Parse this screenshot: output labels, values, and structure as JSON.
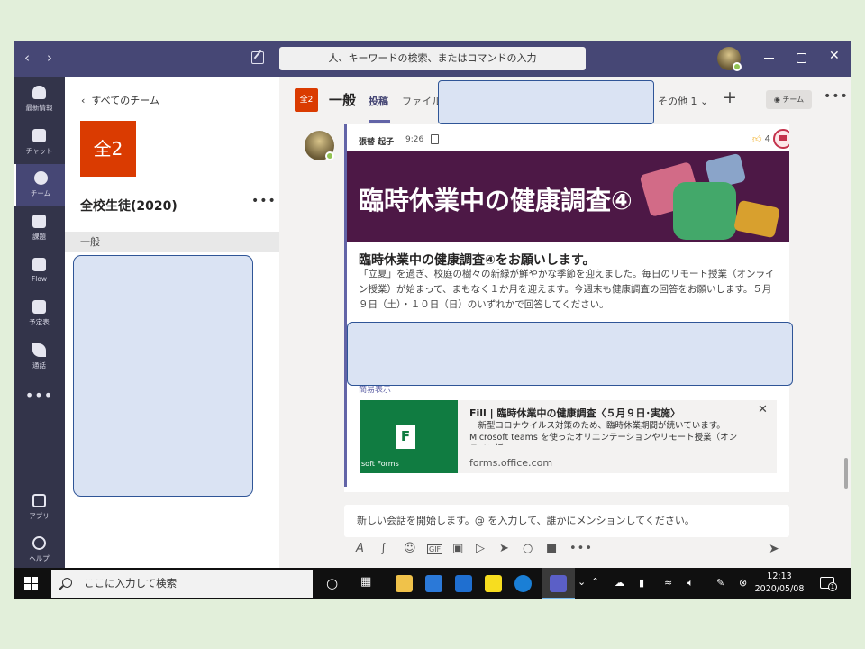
{
  "titlebar": {
    "search_placeholder": "人、キーワードの検索、またはコマンドの入力"
  },
  "rail": [
    {
      "label": "最新情報",
      "icon": "bell-icon"
    },
    {
      "label": "チャット",
      "icon": "chat-icon"
    },
    {
      "label": "チーム",
      "icon": "teams-icon"
    },
    {
      "label": "課題",
      "icon": "assignments-icon"
    },
    {
      "label": "Flow",
      "icon": "flow-icon"
    },
    {
      "label": "予定表",
      "icon": "calendar-icon"
    },
    {
      "label": "通話",
      "icon": "phone-icon"
    },
    {
      "label": "アプリ",
      "icon": "apps-icon"
    },
    {
      "label": "ヘルプ",
      "icon": "help-icon"
    }
  ],
  "team_panel": {
    "back_label": "すべてのチーム",
    "tile": "全2",
    "team_name": "全校生徒(2020)",
    "channel": "一般"
  },
  "channel_header": {
    "tile": "全2",
    "name": "一般",
    "tabs": [
      "投稿",
      "ファイル"
    ],
    "more_tabs": "その他 1",
    "team_button": "チーム"
  },
  "post": {
    "author": "張替 起子",
    "time": "9:26",
    "likes": "4",
    "banner_title": "臨時休業中の健康調査④",
    "title": "臨時休業中の健康調査④をお願いします。",
    "body": "「立夏」を過ぎ、校庭の樹々の新緑が鮮やかな季節を迎えました。毎日のリモート授業（オンライン授業）が始まって、まもなく１か月を迎えます。今週末も健康調査の回答をお願いします。５月９日（土）・１０日（日）のいずれかで回答してください。",
    "show_less": "簡易表示",
    "link_card": {
      "thumb_caption": "soft Forms",
      "title": "Fill | 臨時休業中の健康調査〈５月９日･実施〉",
      "description": "　新型コロナウイルス対策のため、臨時休業期間が続いています。\nMicrosoft teams を使ったオリエンテーションやリモート授業（オンライン授",
      "url": "forms.office.com"
    }
  },
  "composer": {
    "placeholder": "新しい会話を開始します。@ を入力して、誰かにメンションしてください。"
  },
  "taskbar": {
    "search_placeholder": "ここに入力して検索",
    "time": "12:13",
    "date": "2020/05/08",
    "notification_count": "1"
  },
  "colors": {
    "teams_purple": "#464775",
    "rail": "#33344a",
    "accent": "#6264a7",
    "team_tile": "#da3b01",
    "banner": "#4d1846",
    "forms_green": "#107c41",
    "redaction_fill": "#dae3f3",
    "redaction_border": "#2f5597"
  }
}
